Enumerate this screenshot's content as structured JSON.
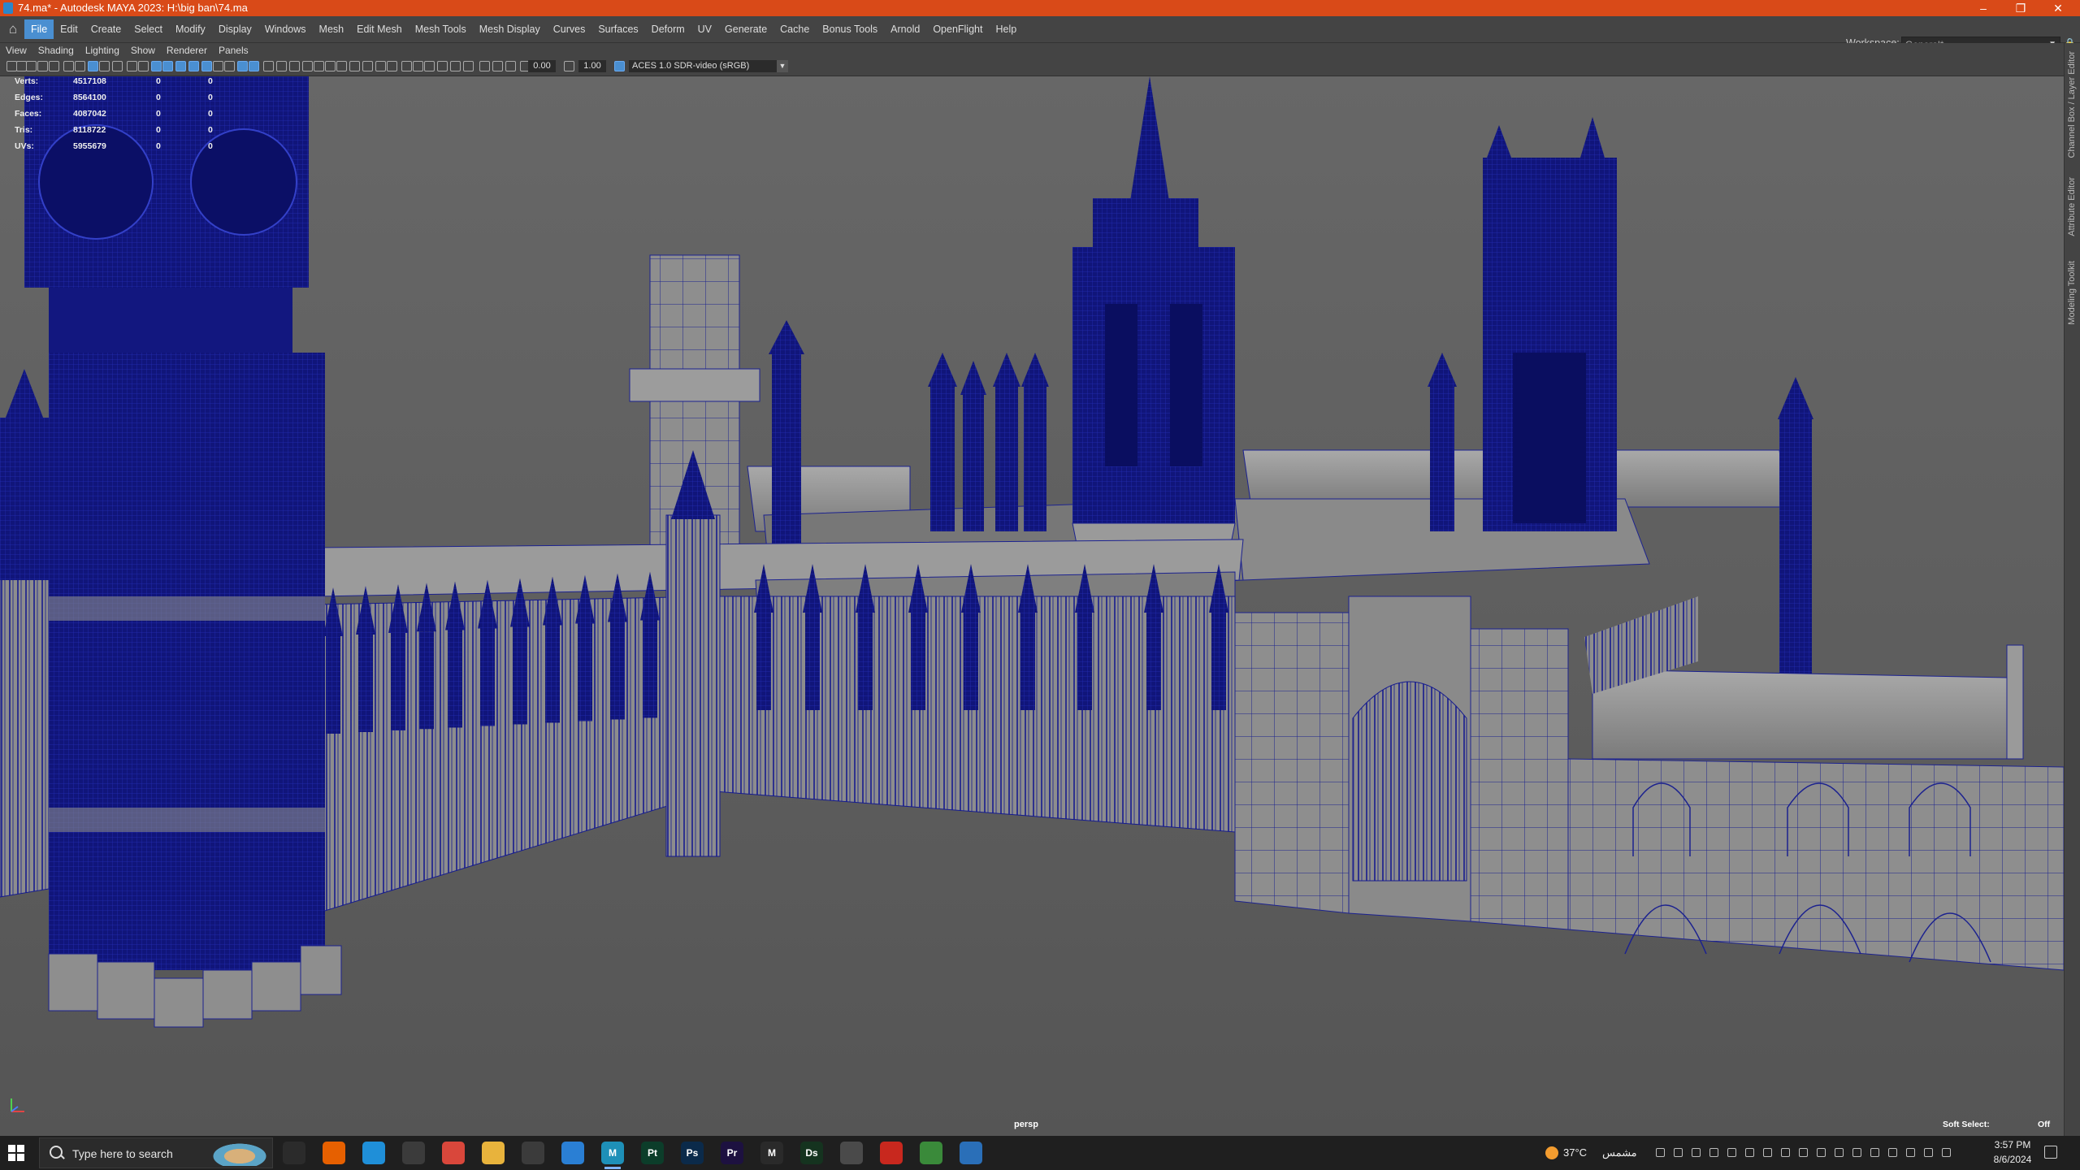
{
  "window": {
    "title": "74.ma* - Autodesk MAYA 2023: H:\\big ban\\74.ma",
    "minimize": "–",
    "maximize": "❐",
    "close": "✕"
  },
  "menubar": {
    "items": [
      "File",
      "Edit",
      "Create",
      "Select",
      "Modify",
      "Display",
      "Windows",
      "Mesh",
      "Edit Mesh",
      "Mesh Tools",
      "Mesh Display",
      "Curves",
      "Surfaces",
      "Deform",
      "UV",
      "Generate",
      "Cache",
      "Bonus Tools",
      "Arnold",
      "OpenFlight",
      "Help"
    ],
    "active": "File",
    "workspace_label": "Workspace:",
    "workspace_value": "General*"
  },
  "panel_menu": [
    "View",
    "Shading",
    "Lighting",
    "Show",
    "Renderer",
    "Panels"
  ],
  "toolbar": {
    "exposure": "0.00",
    "gamma": "1.00",
    "color_space": "ACES 1.0 SDR-video (sRGB)"
  },
  "hud": {
    "rows": [
      {
        "label": "Verts:",
        "total": "4517108",
        "sel": "0",
        "comp": "0"
      },
      {
        "label": "Edges:",
        "total": "8564100",
        "sel": "0",
        "comp": "0"
      },
      {
        "label": "Faces:",
        "total": "4087042",
        "sel": "0",
        "comp": "0"
      },
      {
        "label": "Tris:",
        "total": "8118722",
        "sel": "0",
        "comp": "0"
      },
      {
        "label": "UVs:",
        "total": "5955679",
        "sel": "0",
        "comp": "0"
      }
    ],
    "camera": "persp",
    "soft_select_label": "Soft Select:",
    "soft_select_value": "Off"
  },
  "right_dock_tabs": [
    "Channel Box / Layer Editor",
    "Attribute Editor",
    "Modeling Toolkit"
  ],
  "taskbar": {
    "search_placeholder": "Type here to search",
    "apps": [
      {
        "name": "task-view",
        "label": "",
        "color": "#2b2b2b"
      },
      {
        "name": "firefox",
        "label": "",
        "color": "#e66000"
      },
      {
        "name": "edge",
        "label": "",
        "color": "#1f8fd8"
      },
      {
        "name": "store",
        "label": "",
        "color": "#3b3b3b"
      },
      {
        "name": "chrome",
        "label": "",
        "color": "#d9473b"
      },
      {
        "name": "explorer",
        "label": "",
        "color": "#e8b33c"
      },
      {
        "name": "app-q",
        "label": "",
        "color": "#3b3b3b"
      },
      {
        "name": "app-blue",
        "label": "",
        "color": "#2a7fd4"
      },
      {
        "name": "maya",
        "label": "M",
        "color": "#1e90b8"
      },
      {
        "name": "painter",
        "label": "Pt",
        "color": "#0c3d2a"
      },
      {
        "name": "photoshop",
        "label": "Ps",
        "color": "#0b2a4a"
      },
      {
        "name": "premiere",
        "label": "Pr",
        "color": "#1d1140"
      },
      {
        "name": "marmoset",
        "label": "M",
        "color": "#2a2a2a"
      },
      {
        "name": "designer",
        "label": "Ds",
        "color": "#15331f"
      },
      {
        "name": "app-photo",
        "label": "",
        "color": "#4a4a4a"
      },
      {
        "name": "app-red",
        "label": "",
        "color": "#c8281e"
      },
      {
        "name": "app-green",
        "label": "",
        "color": "#3a8a3a"
      },
      {
        "name": "app-ring",
        "label": "",
        "color": "#2a6fb8"
      }
    ],
    "active_app": "maya",
    "weather_temp": "37°C",
    "weather_desc": "مشمس",
    "time": "3:57 PM",
    "date": "8/6/2024"
  },
  "colors": {
    "titlebar": "#d94a18",
    "accent": "#4a8fd1",
    "wireframe": "#141a8c",
    "viewport_bg": "#5d5d5d"
  }
}
